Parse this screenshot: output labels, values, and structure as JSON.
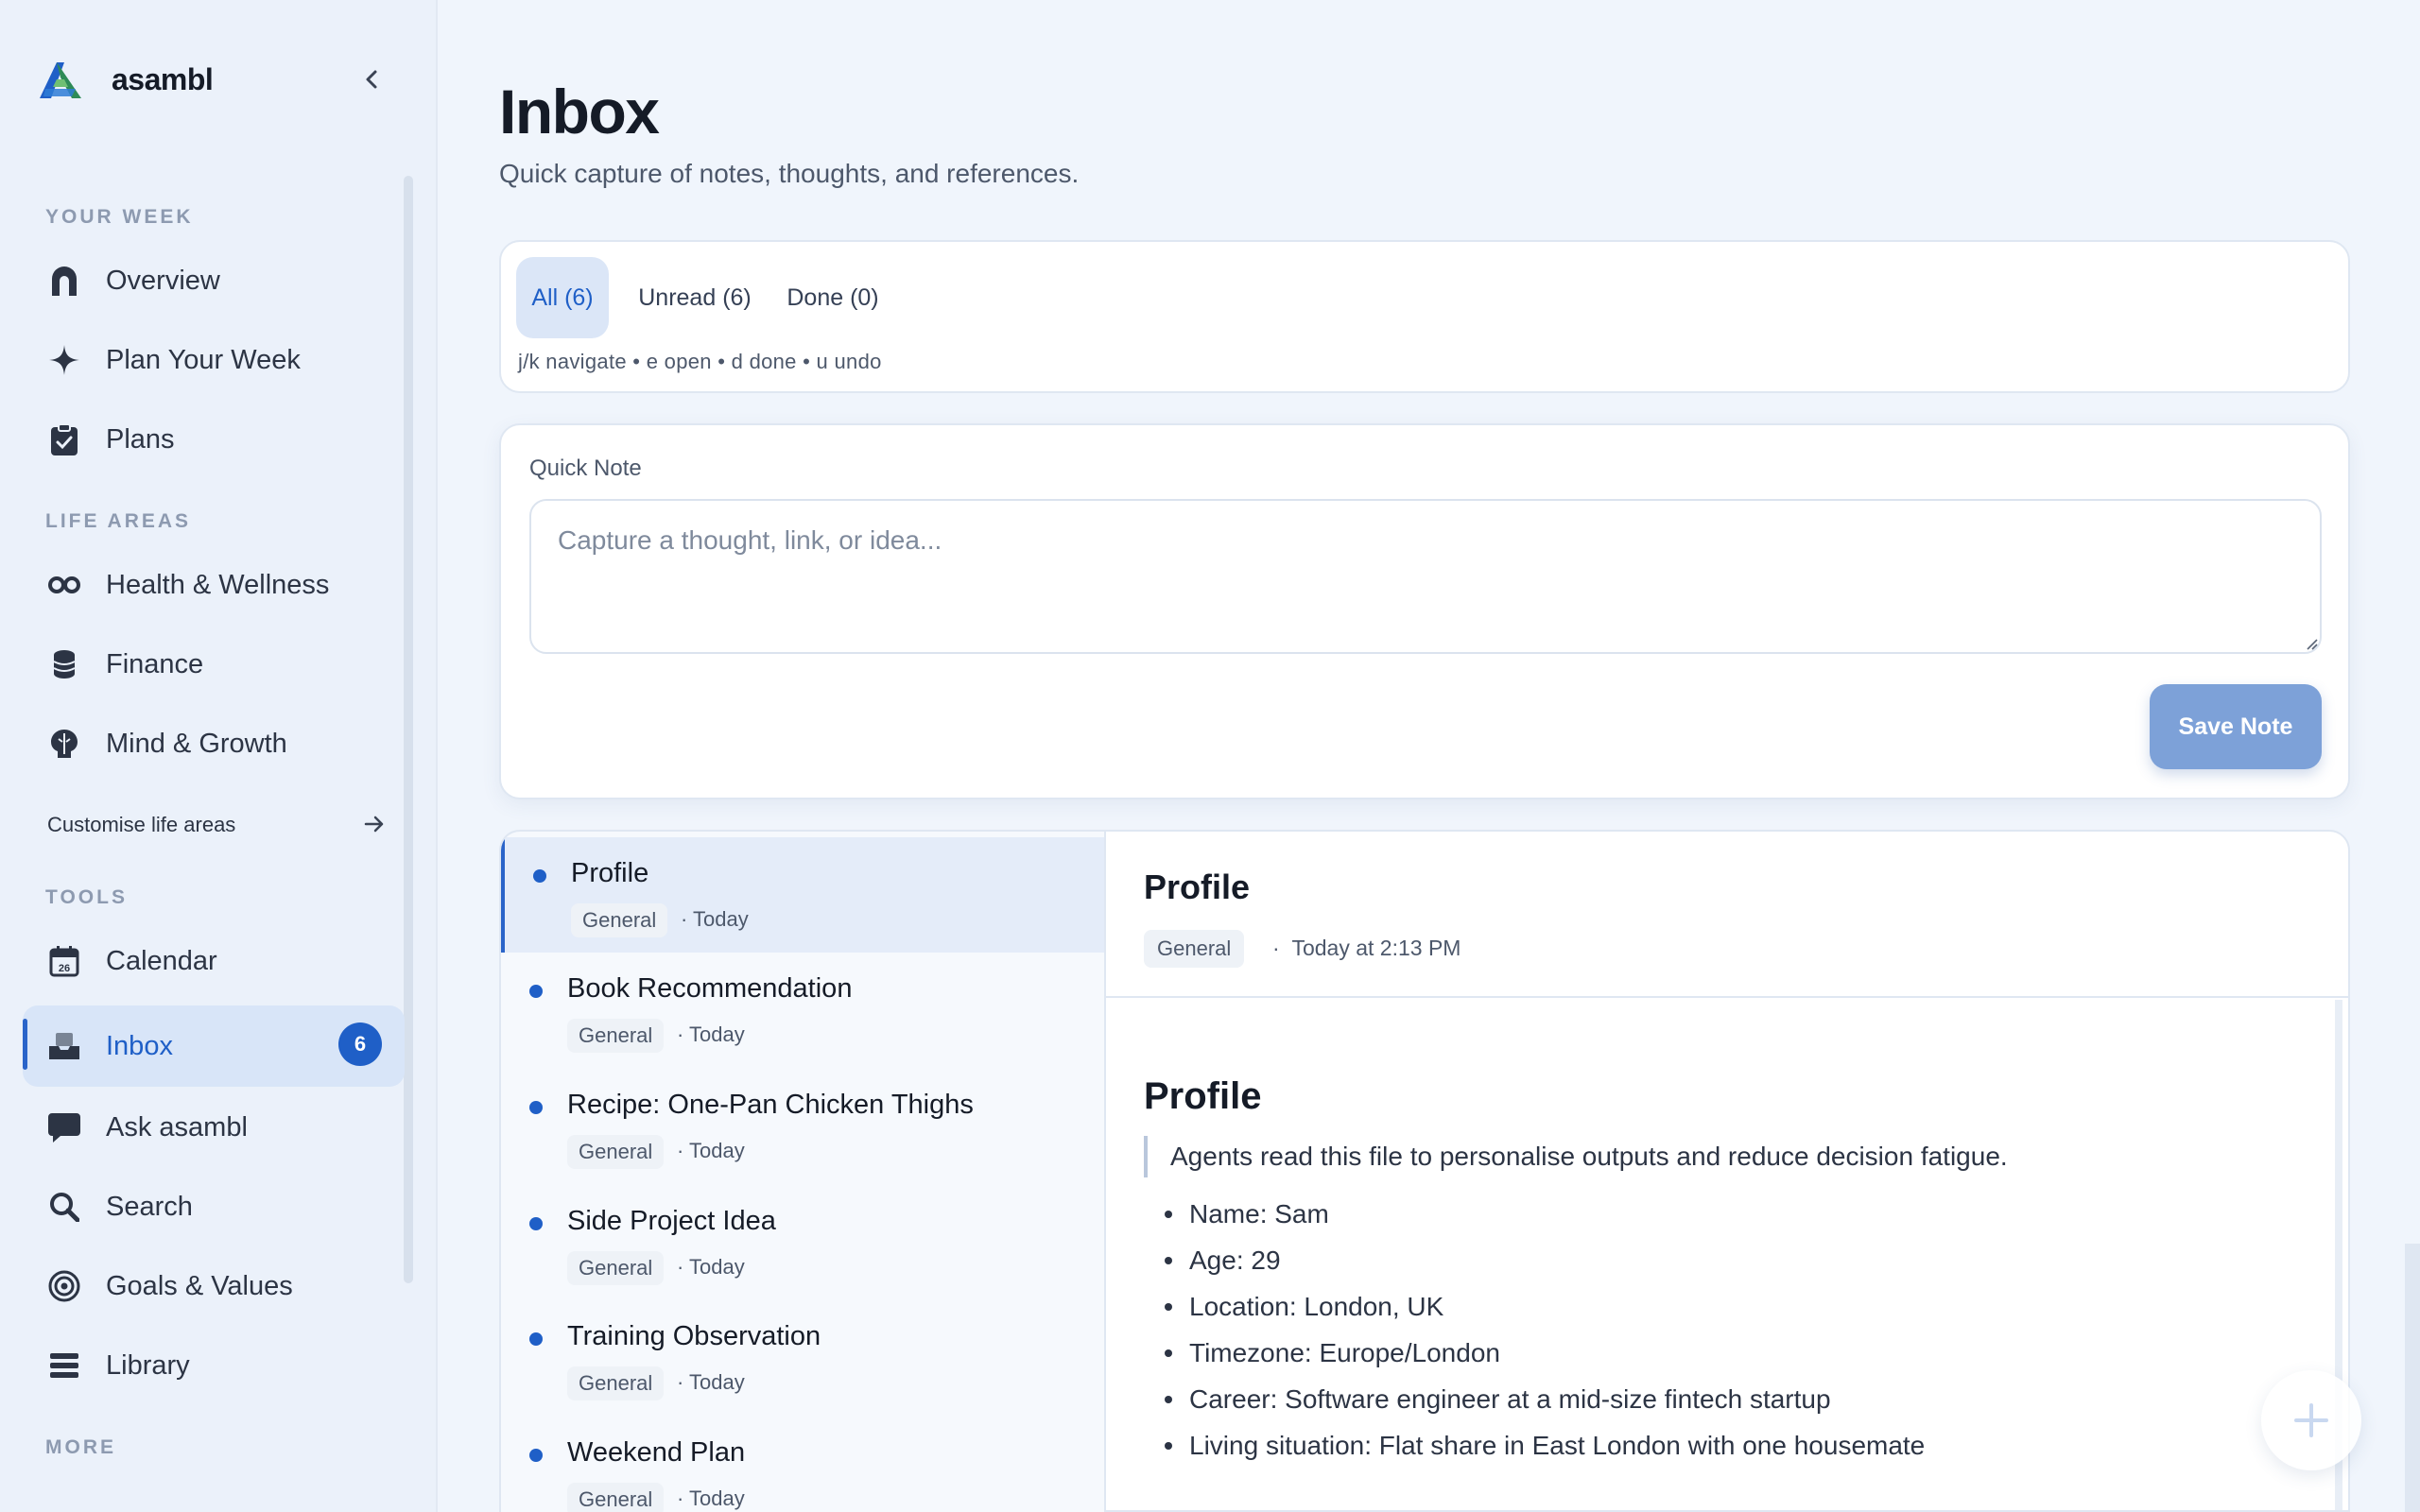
{
  "brand": {
    "name": "asambl"
  },
  "sidebar": {
    "section_week": "YOUR WEEK",
    "week_items": [
      {
        "label": "Overview",
        "icon": "home-arch-icon"
      },
      {
        "label": "Plan Your Week",
        "icon": "sparkle-icon"
      },
      {
        "label": "Plans",
        "icon": "clipboard-check-icon"
      }
    ],
    "section_life": "LIFE AREAS",
    "life_items": [
      {
        "label": "Health & Wellness",
        "icon": "infinity-icon"
      },
      {
        "label": "Finance",
        "icon": "coins-stack-icon"
      },
      {
        "label": "Mind & Growth",
        "icon": "brain-icon"
      }
    ],
    "customise_label": "Customise life areas",
    "section_tools": "TOOLS",
    "tool_items": [
      {
        "label": "Calendar",
        "icon": "calendar-icon"
      },
      {
        "label": "Inbox",
        "icon": "inbox-tray-icon",
        "badge": "6",
        "active": true
      },
      {
        "label": "Ask asambl",
        "icon": "chat-bubble-icon"
      },
      {
        "label": "Search",
        "icon": "search-icon"
      },
      {
        "label": "Goals & Values",
        "icon": "target-icon"
      },
      {
        "label": "Library",
        "icon": "stack-icon"
      }
    ],
    "section_more": "MORE",
    "calendar_day": "26"
  },
  "main": {
    "title": "Inbox",
    "subtitle": "Quick capture of notes, thoughts, and references.",
    "tabs": [
      {
        "label": "All (6)",
        "active": true
      },
      {
        "label": "Unread (6)",
        "active": false
      },
      {
        "label": "Done (0)",
        "active": false
      }
    ],
    "shortcuts": "j/k navigate • e open • d done • u undo",
    "quick_note": {
      "label": "Quick Note",
      "placeholder": "Capture a thought, link, or idea...",
      "value": "",
      "save_label": "Save Note"
    },
    "notes": [
      {
        "title": "Profile",
        "tag": "General",
        "when": "Today",
        "selected": true
      },
      {
        "title": "Book Recommendation",
        "tag": "General",
        "when": "Today"
      },
      {
        "title": "Recipe: One-Pan Chicken Thighs",
        "tag": "General",
        "when": "Today"
      },
      {
        "title": "Side Project Idea",
        "tag": "General",
        "when": "Today"
      },
      {
        "title": "Training Observation",
        "tag": "General",
        "when": "Today"
      },
      {
        "title": "Weekend Plan",
        "tag": "General",
        "when": "Today"
      }
    ],
    "detail": {
      "title": "Profile",
      "tag": "General",
      "when": "Today at 2:13 PM",
      "body_heading": "Profile",
      "quote": "Agents read this file to personalise outputs and reduce decision fatigue.",
      "facts": [
        "Name: Sam",
        "Age: 29",
        "Location: London, UK",
        "Timezone: Europe/London",
        "Career: Software engineer at a mid-size fintech startup",
        "Living situation: Flat share in East London with one housemate"
      ]
    }
  },
  "colors": {
    "accent": "#1f5fc7",
    "save_button": "#7da1d8",
    "background": "#f0f5fc"
  }
}
